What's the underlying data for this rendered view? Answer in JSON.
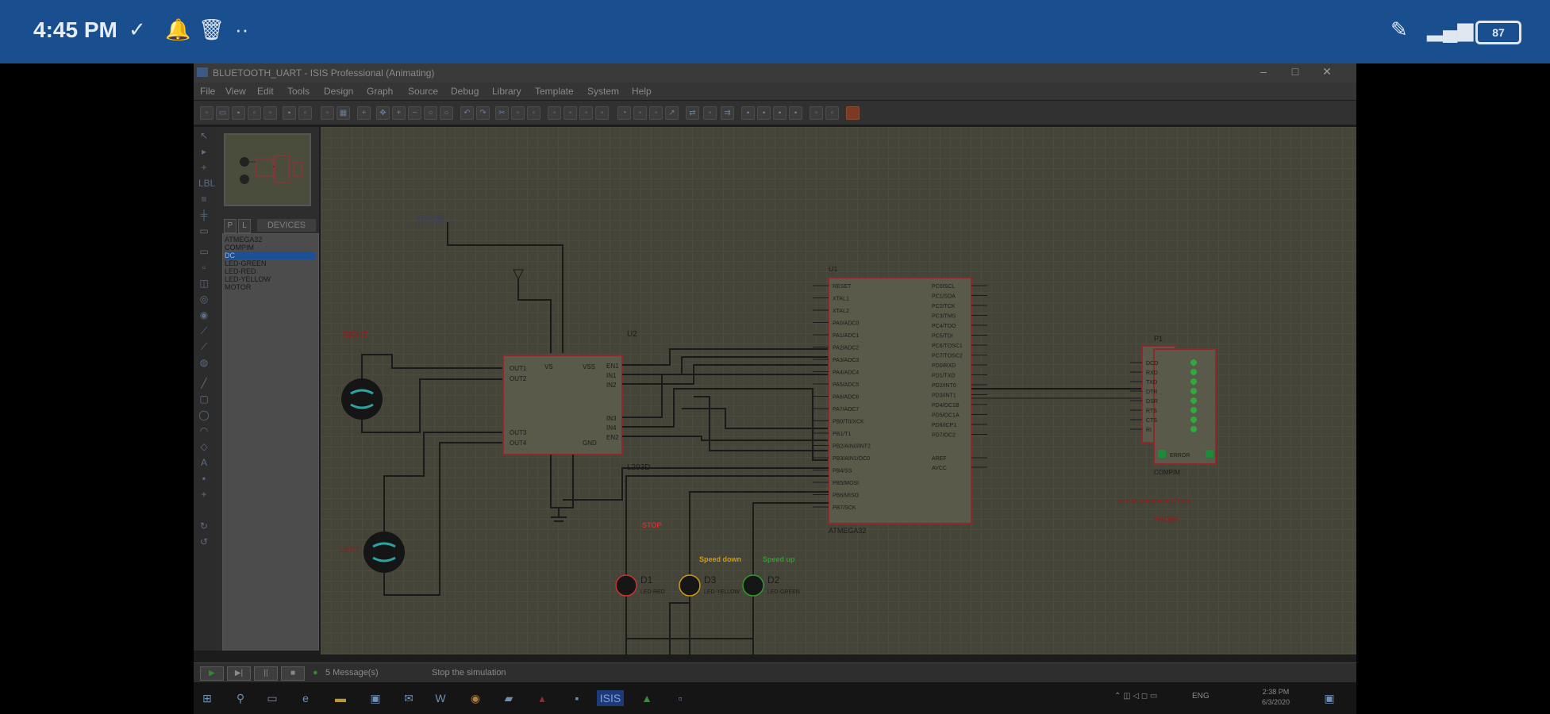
{
  "status_bar": {
    "time": "4:45 PM",
    "battery": "87"
  },
  "window": {
    "title": "BLUETOOTH_UART - ISIS Professional (Animating)",
    "controls": {
      "minimize": "–",
      "maximize": "□",
      "close": "✕"
    }
  },
  "menu": [
    "File",
    "View",
    "Edit",
    "Tools",
    "Design",
    "Graph",
    "Source",
    "Debug",
    "Library",
    "Template",
    "System",
    "Help"
  ],
  "device_pane": {
    "buttons": [
      "P",
      "L"
    ],
    "header": "DEVICES",
    "items": [
      "ATMEGA32",
      "COMPIM",
      "DC",
      "LED-GREEN",
      "LED-RED",
      "LED-YELLOW",
      "MOTOR"
    ],
    "selected_index": 2
  },
  "schematic": {
    "power_label": "VBV500",
    "motor_right_label": "RIGHT",
    "motor_left_label": "LEFT",
    "driver": {
      "ref": "U2",
      "part": "L293D",
      "pins_left": [
        "OUT1",
        "OUT2",
        "OUT3",
        "OUT4"
      ],
      "pins_mid": [
        "VS",
        "VSS",
        "GND"
      ],
      "pins_right": [
        "EN1",
        "IN1",
        "IN2",
        "IN3",
        "IN4",
        "EN2"
      ]
    },
    "mcu": {
      "ref": "U1",
      "part": "ATMEGA32",
      "pins_left": [
        "RESET",
        "XTAL1",
        "XTAL2",
        "PA0/ADC0",
        "PA1/ADC1",
        "PA2/ADC2",
        "PA3/ADC3",
        "PA4/ADC4",
        "PA5/ADC5",
        "PA6/ADC6",
        "PA7/ADC7",
        "PB0/T0/XCK",
        "PB1/T1",
        "PB2/AIN0/INT2",
        "PB3/AIN1/OC0",
        "PB4/SS",
        "PB5/MOSI",
        "PB6/MISO",
        "PB7/SCK"
      ],
      "pins_right": [
        "PC0/SCL",
        "PC1/SDA",
        "PC2/TCK",
        "PC3/TMS",
        "PC4/TDO",
        "PC5/TDI",
        "PC6/TOSC1",
        "PC7/TOSC2",
        "PD0/RXD",
        "PD1/TXD",
        "PD2/INT0",
        "PD3/INT1",
        "PD4/OC1B",
        "PD5/OC1A",
        "PD6/ICP1",
        "PD7/OC2",
        "AREF",
        "AVCC"
      ]
    },
    "connector": {
      "ref": "P1",
      "part": "COMPIM",
      "pins": [
        "DCD",
        "RXD",
        "TXD",
        "DTR",
        "DSR",
        "RTS",
        "CTS",
        "RI"
      ],
      "inner_label": "ERROR"
    },
    "serial_note_line1": "serial command from",
    "serial_note_line2": "PHONE",
    "leds": [
      {
        "ref": "D1",
        "part": "LED-RED",
        "note": "STOP",
        "color": "#d03030"
      },
      {
        "ref": "D3",
        "part": "LED-YELLOW",
        "note": "Speed down",
        "color": "#d09a10"
      },
      {
        "ref": "D2",
        "part": "LED-GREEN",
        "note": "Speed up",
        "color": "#2f9a2f"
      }
    ]
  },
  "status_strip": {
    "messages": "5 Message(s)",
    "hint": "Stop the simulation"
  },
  "taskbar": {
    "clock_time": "2:38 PM",
    "clock_date": "6/3/2020",
    "lang": "ENG",
    "isis_label": "ISIS"
  }
}
